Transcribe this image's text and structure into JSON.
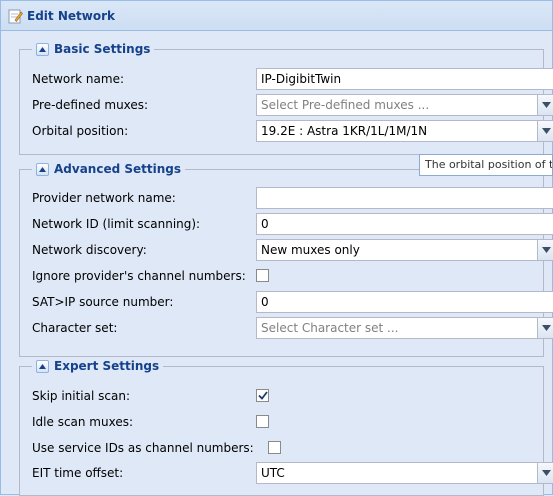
{
  "window": {
    "title": "Edit Network",
    "icon": "edit-icon"
  },
  "basic": {
    "legend": "Basic Settings",
    "network_name": {
      "label": "Network name:",
      "value": "IP-DigibitTwin"
    },
    "predefined_muxes": {
      "label": "Pre-defined muxes:",
      "placeholder": "Select Pre-defined muxes ..."
    },
    "orbital_position": {
      "label": "Orbital position:",
      "value": "19.2E : Astra 1KR/1L/1M/1N"
    }
  },
  "advanced": {
    "legend": "Advanced Settings",
    "provider_network_name": {
      "label": "Provider network name:",
      "value": ""
    },
    "network_id": {
      "label": "Network ID (limit scanning):",
      "value": "0"
    },
    "network_discovery": {
      "label": "Network discovery:",
      "value": "New muxes only"
    },
    "ignore_channel_numbers": {
      "label": "Ignore provider's channel numbers:",
      "checked": false
    },
    "satip_source": {
      "label": "SAT>IP source number:",
      "value": "0"
    },
    "character_set": {
      "label": "Character set:",
      "placeholder": "Select Character set ..."
    }
  },
  "expert": {
    "legend": "Expert Settings",
    "skip_initial_scan": {
      "label": "Skip initial scan:",
      "checked": true
    },
    "idle_scan_muxes": {
      "label": "Idle scan muxes:",
      "checked": false
    },
    "service_ids": {
      "label": "Use service IDs as channel numbers:",
      "checked": false
    },
    "eit_offset": {
      "label": "EIT time offset:",
      "value": "UTC"
    }
  },
  "tooltip": {
    "text": "The orbital position of the satellite your dish is pointing at."
  },
  "colors": {
    "header_text": "#15428b",
    "panel_bg": "#dfe8f6",
    "border": "#99bbe8"
  }
}
